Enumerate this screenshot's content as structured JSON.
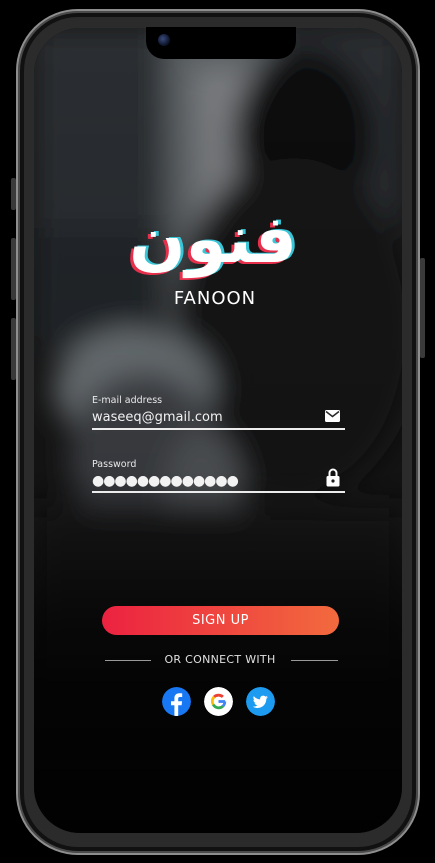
{
  "app": {
    "brand_name": "FANOON",
    "logo_text": "فنون"
  },
  "form": {
    "email_label": "E-mail address",
    "email_value": "waseeq@gmail.com",
    "password_label": "Password",
    "password_value": "●●●●●●●●●●●●●"
  },
  "actions": {
    "signup_label": "SIGN UP",
    "or_connect_label": "OR CONNECT WITH"
  },
  "social": [
    {
      "name": "facebook",
      "icon": "facebook-icon",
      "color": "#1877F2"
    },
    {
      "name": "google",
      "icon": "google-icon",
      "color": "#ffffff"
    },
    {
      "name": "twitter",
      "icon": "twitter-icon",
      "color": "#1D9BF0"
    }
  ],
  "colors": {
    "accent_start": "#ec2240",
    "accent_end": "#f26a3e"
  }
}
